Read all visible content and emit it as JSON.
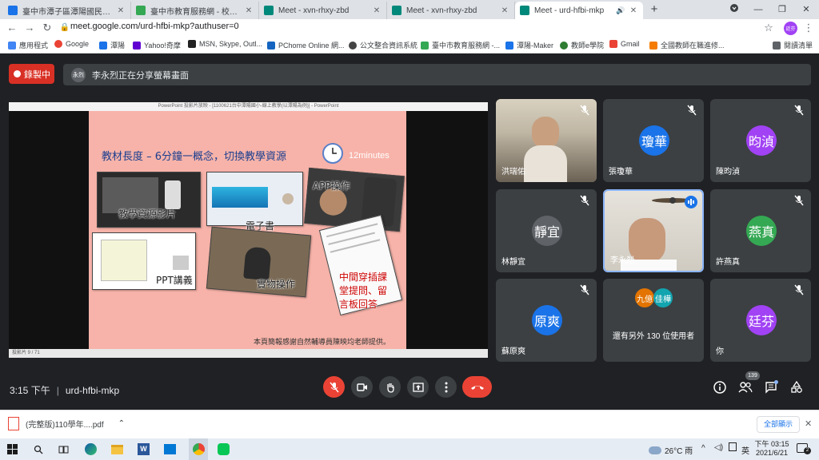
{
  "browser": {
    "tabs": [
      {
        "title": "臺中市潭子區潭陽國民小學",
        "favicon_color": "#1a73e8"
      },
      {
        "title": "臺中市教育服務網 - 校園活動報名",
        "favicon_color": "#34a853"
      },
      {
        "title": "Meet - xvn-rhxy-zbd",
        "favicon_color": "#00897b"
      },
      {
        "title": "Meet - xvn-rhxy-zbd",
        "favicon_color": "#00897b"
      },
      {
        "title": "Meet - urd-hfbi-mkp",
        "favicon_color": "#00897b"
      }
    ],
    "new_tab": "+",
    "url": "meet.google.com/urd-hfbi-mkp?authuser=0",
    "profile_initials": "廷芬",
    "bookmarks": [
      {
        "label": "應用程式",
        "color": "#4285f4"
      },
      {
        "label": "Google",
        "color": "#ea4335"
      },
      {
        "label": "潭陽",
        "color": "#1a73e8"
      },
      {
        "label": "Yahoo!奇摩",
        "color": "#6001d2"
      },
      {
        "label": "MSN, Skype, Outl...",
        "color": "#222222"
      },
      {
        "label": "PChome Online 網...",
        "color": "#1565c0"
      },
      {
        "label": "公文整合資訊系統",
        "color": "#444444"
      },
      {
        "label": "臺中市教育服務網 -...",
        "color": "#34a853"
      },
      {
        "label": "潭陽-Maker",
        "color": "#1a73e8"
      },
      {
        "label": "教師e學院",
        "color": "#2e7d32"
      },
      {
        "label": "Gmail",
        "color": "#ea4335"
      },
      {
        "label": "全國教師在職進修...",
        "color": "#f57c00"
      }
    ],
    "reading_list": "閱讀清單"
  },
  "meet": {
    "recording_label": "錄製中",
    "presenter_initials": "永烈",
    "presenting_text": "李永烈正在分享螢幕畫面",
    "presentation": {
      "window_title": "PowerPoint 投影片放映 - [1100621台中潭陽國小-線上教學(以潭陽為例)] - PowerPoint",
      "slide_title": "教材長度 – 6分鐘一概念，切換教學資源",
      "clock_label": "12minutes",
      "labels": [
        "教學資源影片",
        "電子書",
        "APP操作",
        "PPT講義",
        "實物操作",
        "中間穿插課堂提問、留言板回答"
      ],
      "credit": "本頁簡報感謝自然輔導員陳映均老師提供。",
      "status": "投影片 9 / 71"
    },
    "participants": [
      {
        "name": "洪瑞佑",
        "initials": "",
        "color": "",
        "video": true,
        "muted": true
      },
      {
        "name": "張瓊華",
        "initials": "瓊華",
        "color": "#1a73e8",
        "video": false,
        "muted": true
      },
      {
        "name": "陳昀湞",
        "initials": "昀湞",
        "color": "#a142f4",
        "video": false,
        "muted": true
      },
      {
        "name": "林靜宜",
        "initials": "靜宜",
        "color": "#5f6368",
        "video": false,
        "muted": true
      },
      {
        "name": "李永烈",
        "initials": "",
        "color": "",
        "video": true,
        "muted": false
      },
      {
        "name": "許燕真",
        "initials": "燕真",
        "color": "#34a853",
        "video": false,
        "muted": true
      },
      {
        "name": "蘇原爽",
        "initials": "原爽",
        "color": "#1a73e8",
        "video": false,
        "muted": true
      },
      {
        "name": "還有另外 130 位使用者",
        "initials": "",
        "color": "",
        "video": false,
        "muted": false
      },
      {
        "name": "你",
        "initials": "廷芬",
        "color": "#a142f4",
        "video": false,
        "muted": true
      }
    ],
    "others_avatars": [
      {
        "initials": "九億",
        "color": "#e37400"
      },
      {
        "initials": "佳樺",
        "color": "#12a4af"
      }
    ],
    "time": "3:15 下午",
    "meeting_code": "urd-hfbi-mkp",
    "people_count": "139"
  },
  "download": {
    "filename": "(完整版)110學年....pdf",
    "show_all": "全部顯示"
  },
  "taskbar": {
    "weather": "26°C 雨",
    "ime": "英",
    "time": "下午 03:15",
    "date": "2021/6/21",
    "notif_count": "2"
  }
}
